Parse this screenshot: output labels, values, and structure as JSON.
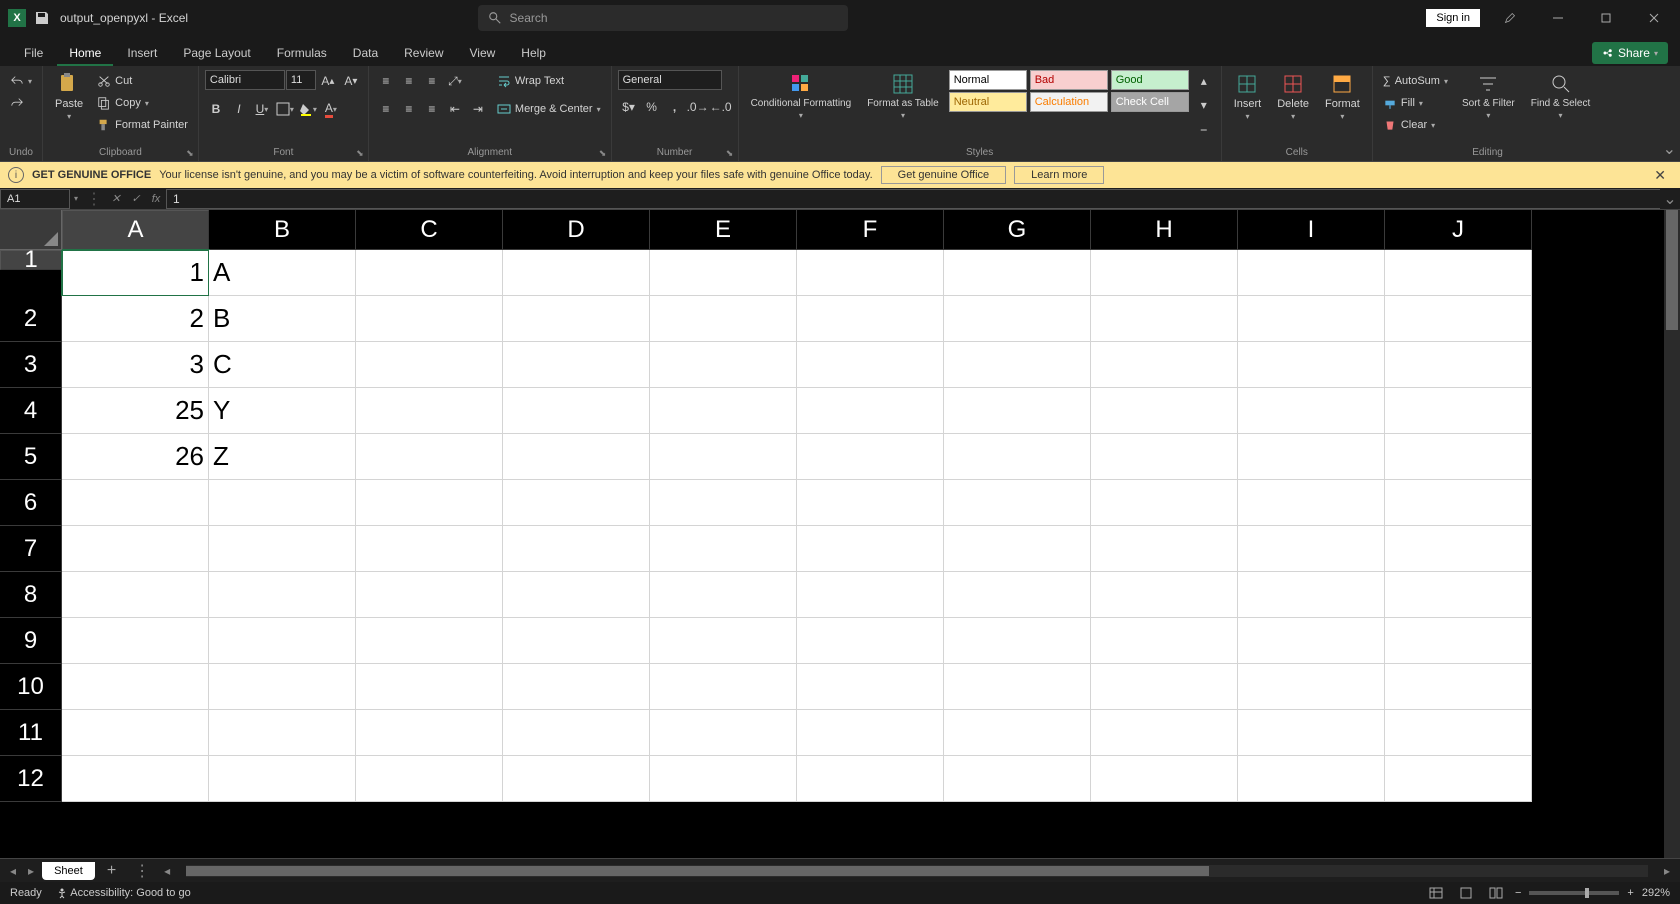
{
  "titlebar": {
    "document_name": "output_openpyxl",
    "app_name": "Excel",
    "search_placeholder": "Search",
    "signin": "Sign in"
  },
  "ribbon": {
    "tabs": [
      "File",
      "Home",
      "Insert",
      "Page Layout",
      "Formulas",
      "Data",
      "Review",
      "View",
      "Help"
    ],
    "active_tab": "Home",
    "share": "Share",
    "groups": {
      "undo": "Undo",
      "clipboard": "Clipboard",
      "font": "Font",
      "alignment": "Alignment",
      "number": "Number",
      "styles": "Styles",
      "cells": "Cells",
      "editing": "Editing"
    },
    "clipboard": {
      "paste": "Paste",
      "cut": "Cut",
      "copy": "Copy",
      "format_painter": "Format Painter"
    },
    "font_group": {
      "name": "Calibri",
      "size": "11"
    },
    "alignment": {
      "wrap": "Wrap Text",
      "merge": "Merge & Center"
    },
    "number": {
      "format": "General"
    },
    "styles_btns": {
      "cond": "Conditional Formatting",
      "table": "Format as Table"
    },
    "style_cells": {
      "normal": "Normal",
      "bad": "Bad",
      "good": "Good",
      "neutral": "Neutral",
      "calc": "Calculation",
      "check": "Check Cell"
    },
    "cells_btns": {
      "insert": "Insert",
      "delete": "Delete",
      "format": "Format"
    },
    "editing": {
      "autosum": "AutoSum",
      "fill": "Fill",
      "clear": "Clear",
      "sort": "Sort & Filter",
      "find": "Find & Select"
    }
  },
  "warning": {
    "label": "GET GENUINE OFFICE",
    "text": "Your license isn't genuine, and you may be a victim of software counterfeiting. Avoid interruption and keep your files safe with genuine Office today.",
    "btn1": "Get genuine Office",
    "btn2": "Learn more"
  },
  "formula_bar": {
    "cell_ref": "A1",
    "formula": "1"
  },
  "sheet": {
    "columns": [
      "A",
      "B",
      "C",
      "D",
      "E",
      "F",
      "G",
      "H",
      "I",
      "J"
    ],
    "active_col": "A",
    "visible_rows": 12,
    "active_row": 1,
    "data": {
      "A1": "1",
      "B1": "A",
      "A2": "2",
      "B2": "B",
      "A3": "3",
      "B3": "C",
      "A4": "25",
      "B4": "Y",
      "A5": "26",
      "B5": "Z"
    },
    "tab_name": "Sheet"
  },
  "statusbar": {
    "ready": "Ready",
    "accessibility": "Accessibility: Good to go",
    "zoom": "292%"
  }
}
